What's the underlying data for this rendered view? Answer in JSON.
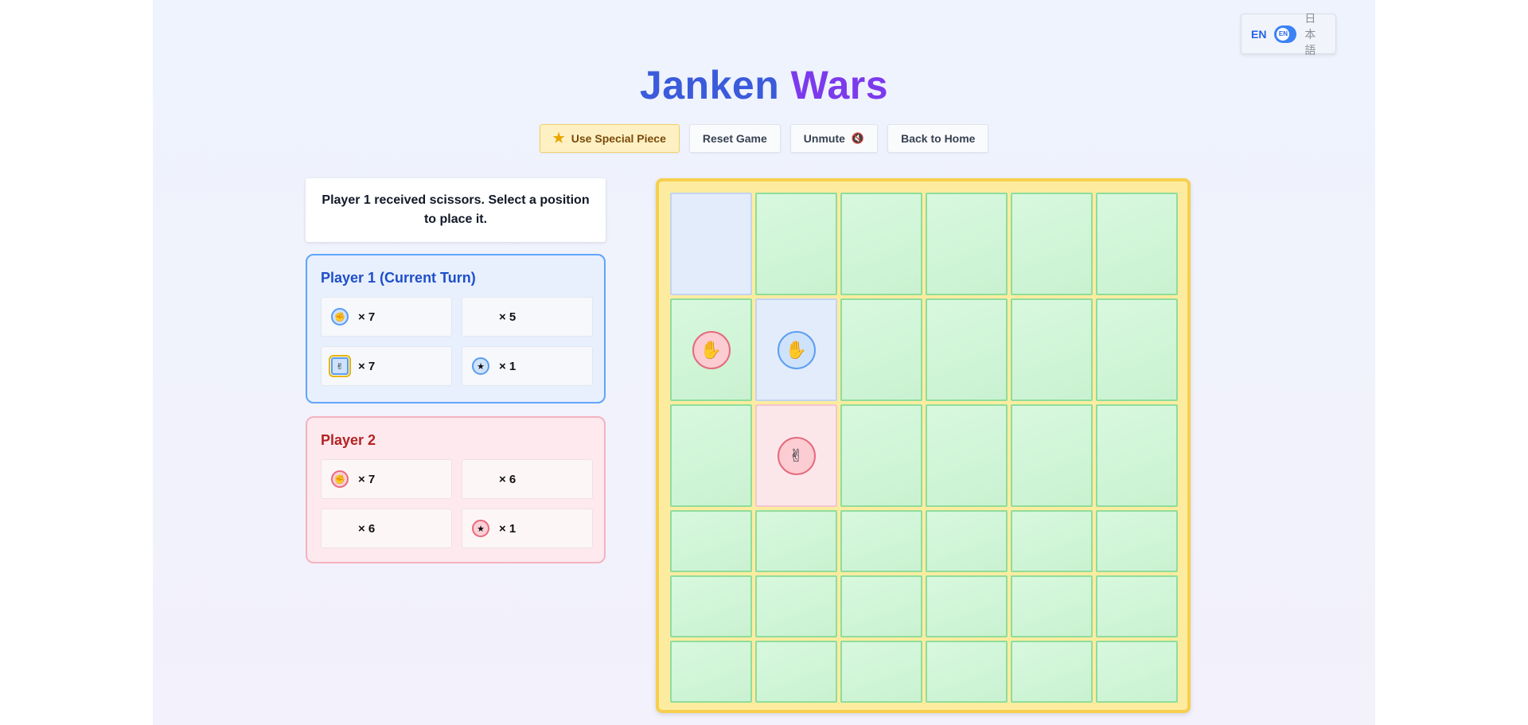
{
  "lang": {
    "en": "EN",
    "ja": "日本語",
    "knob": "EN"
  },
  "title": {
    "part1": "Janken",
    "part2": "Wars"
  },
  "toolbar": {
    "special": "Use Special Piece",
    "reset": "Reset Game",
    "unmute": "Unmute",
    "home": "Back to Home"
  },
  "message": "Player 1 received scissors. Select a position to place it.",
  "player1": {
    "title": "Player 1 (Current Turn)",
    "counts": [
      {
        "icon": "rock-icon",
        "glyph": "✊",
        "label": "× 7",
        "color": "blue"
      },
      {
        "icon": "",
        "glyph": "",
        "label": "× 5",
        "color": "blank"
      },
      {
        "icon": "scissors-icon",
        "glyph": "✌",
        "label": "× 7",
        "color": "blue",
        "selected": true
      },
      {
        "icon": "star-icon",
        "glyph": "★",
        "label": "× 1",
        "color": "blue"
      }
    ]
  },
  "player2": {
    "title": "Player 2",
    "counts": [
      {
        "icon": "rock-icon",
        "glyph": "✊",
        "label": "× 7",
        "color": "red"
      },
      {
        "icon": "",
        "glyph": "",
        "label": "× 6",
        "color": "blank"
      },
      {
        "icon": "",
        "glyph": "",
        "label": "× 6",
        "color": "blank"
      },
      {
        "icon": "star-icon",
        "glyph": "★",
        "label": "× 1",
        "color": "red"
      }
    ]
  },
  "board": {
    "rows": 6,
    "cols": 6,
    "highlight": [
      {
        "row": 0,
        "col": 0,
        "color": "blue"
      },
      {
        "row": 1,
        "col": 1,
        "color": "blue"
      },
      {
        "row": 2,
        "col": 1,
        "color": "red"
      }
    ],
    "pieces": [
      {
        "row": 1,
        "col": 0,
        "owner": "red",
        "type": "paper",
        "glyph": "✋",
        "icon": "paper-icon"
      },
      {
        "row": 1,
        "col": 1,
        "owner": "blue",
        "type": "paper",
        "glyph": "✋",
        "icon": "paper-icon"
      },
      {
        "row": 2,
        "col": 1,
        "owner": "red",
        "type": "scissors",
        "glyph": "✌",
        "icon": "scissors-icon"
      }
    ]
  },
  "colors": {
    "player1": "#3b82f6",
    "player2": "#e56a7c",
    "cell": "#c9f2d1",
    "board_border": "#f7cf4f"
  }
}
